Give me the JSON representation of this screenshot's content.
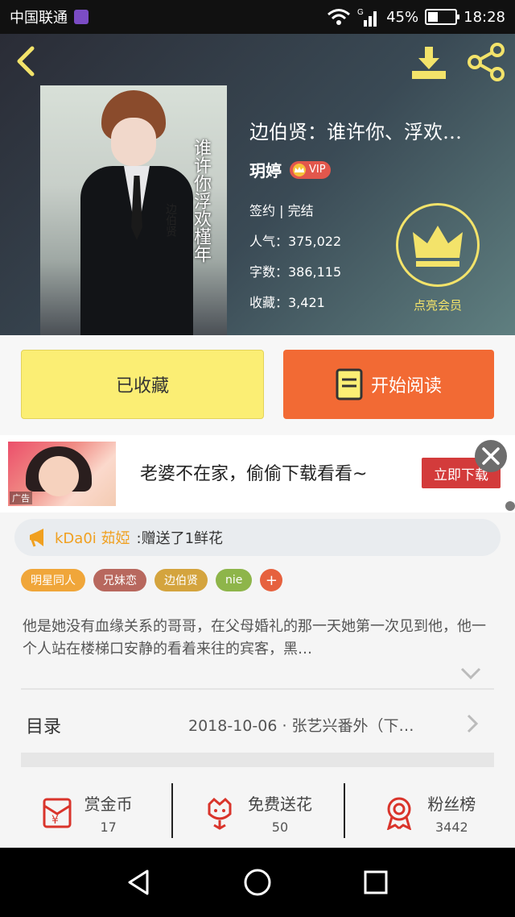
{
  "status_bar": {
    "carrier": "中国联通",
    "network": "G",
    "battery_text": "45%",
    "battery_level": 0.45,
    "time": "18:28"
  },
  "header": {
    "cover_title": "谁许你浮欢槿年",
    "cover_author": "边伯贤",
    "title": "边伯贤：谁许你、浮欢…",
    "author": "玥婷",
    "vip_label": "VIP",
    "status": "签约 | 完结",
    "popularity": "人气：375,022",
    "words": "字数：386,115",
    "favorites": "收藏：3,421",
    "member_label": "点亮会员"
  },
  "actions": {
    "collected_label": "已收藏",
    "read_label": "开始阅读"
  },
  "ad": {
    "tag": "广告",
    "text": "老婆不在家，偷偷下载看看~",
    "download_label": "立即下载"
  },
  "gift": {
    "user": "kDa0i 茹婭",
    "text": ":赠送了1鲜花"
  },
  "tags": [
    "明星同人",
    "兄妹恋",
    "边伯贤",
    "nie"
  ],
  "tag_add": "+",
  "description": "他是她没有血缘关系的哥哥，在父母婚礼的那一天她第一次见到他，他一个人站在楼梯口安静的看着来往的宾客，黑…",
  "toc": {
    "label": "目录",
    "latest": "2018-10-06 · 张艺兴番外（下…"
  },
  "stats": [
    {
      "label": "赏金币",
      "value": "17"
    },
    {
      "label": "免费送花",
      "value": "50"
    },
    {
      "label": "粉丝榜",
      "value": "3442"
    }
  ],
  "colors": {
    "accent_orange": "#f26a34",
    "collected_yellow": "#fbee74",
    "member_gold": "#f3e36a",
    "icon_red": "#d9342b"
  }
}
